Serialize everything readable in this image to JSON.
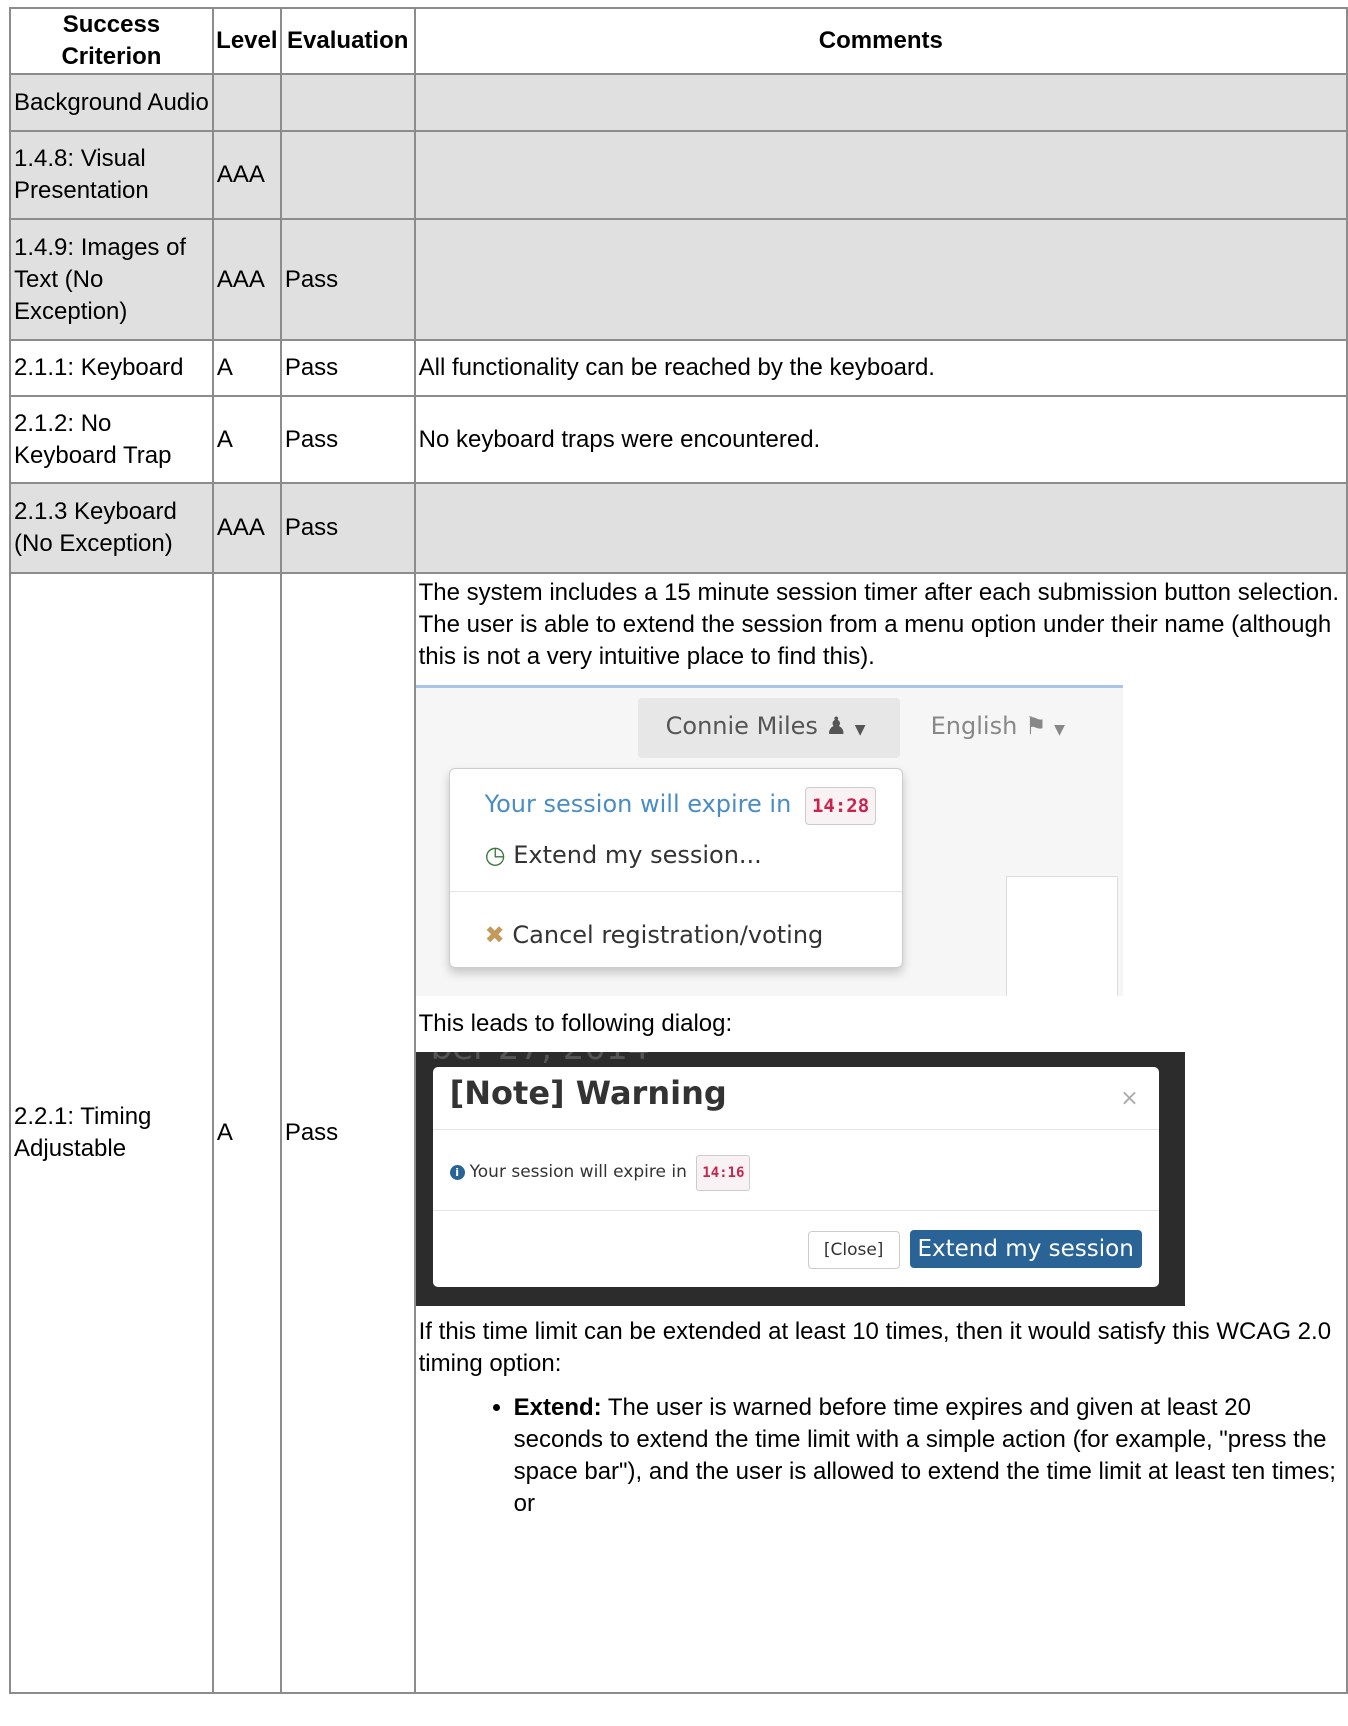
{
  "headers": [
    "Success Criterion",
    "Level",
    "Evaluation",
    "Comments"
  ],
  "rows": [
    {
      "criterion": "Background Audio",
      "level": "",
      "evaluation": "",
      "comments": ""
    },
    {
      "criterion": "1.4.8: Visual Presentation",
      "level": "AAA",
      "evaluation": "",
      "comments": ""
    },
    {
      "criterion": "1.4.9: Images of Text (No Exception)",
      "level": "AAA",
      "evaluation": "Pass",
      "comments": ""
    },
    {
      "criterion": "2.1.1: Keyboard",
      "level": "A",
      "evaluation": "Pass",
      "comments": "All functionality can be reached by the keyboard."
    },
    {
      "criterion": "2.1.2: No Keyboard Trap",
      "level": "A",
      "evaluation": "Pass",
      "comments": "No keyboard traps were encountered."
    },
    {
      "criterion": "2.1.3 Keyboard (No Exception)",
      "level": "AAA",
      "evaluation": "Pass",
      "comments": ""
    }
  ],
  "timing_row": {
    "criterion": "2.2.1: Timing Adjustable",
    "level": "A",
    "evaluation": "Pass",
    "intro": "The system includes a 15 minute session timer after each submission button selection. The user is able to extend the session from a menu option under their name (although this is not a very intuitive place to find this).",
    "screenshot1": {
      "user_name": "Connie Miles",
      "language": "English",
      "expire_text": "Your session will expire in",
      "timer": "14:28",
      "extend_item": "Extend my session...",
      "cancel_item": "Cancel registration/voting"
    },
    "leads_text": "This leads to following dialog:",
    "screenshot2": {
      "background_text": "ber 27, 2014",
      "title": "[Note] Warning",
      "close_x": "×",
      "message": "Your session will expire in",
      "timer": "14:16",
      "close_button": "[Close]",
      "extend_button": "Extend my session"
    },
    "conclusion": "If this time limit can be extended at least 10 times, then it would satisfy this WCAG 2.0 timing option:",
    "bullet_term": "Extend:",
    "bullet_text": " The user is warned before time expires and given at least 20 seconds to extend the time limit with a simple action (for example, \"press the space bar\"), and the user is allowed to extend the time limit at least ten times; or"
  }
}
